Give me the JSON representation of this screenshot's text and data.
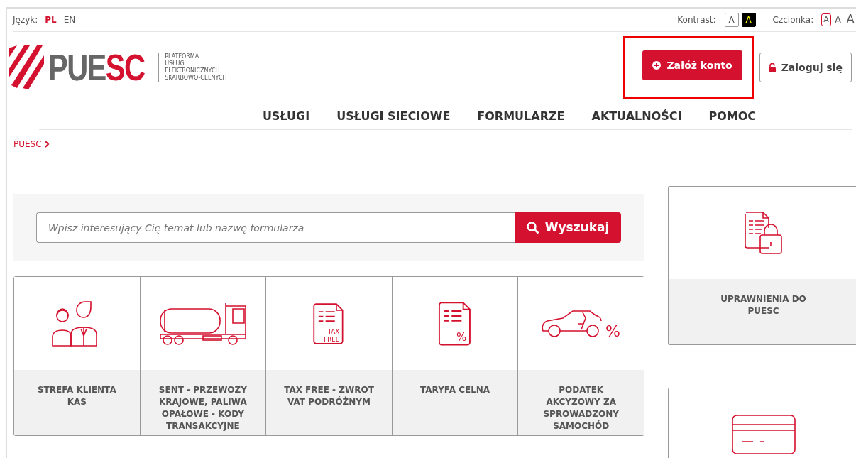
{
  "top_bar": {
    "language_label": "Język:",
    "languages": [
      {
        "label": "PL",
        "selected": true
      },
      {
        "label": "EN",
        "selected": false
      }
    ],
    "contrast_label": "Kontrast:",
    "contrast_options": [
      {
        "label": "A",
        "kind": "normal"
      },
      {
        "label": "A",
        "kind": "high"
      }
    ],
    "font_label": "Czcionka:",
    "font_sizes": [
      {
        "label": "A",
        "selected": true
      },
      {
        "label": "A",
        "selected": false
      },
      {
        "label": "A",
        "selected": false
      }
    ]
  },
  "logo": {
    "wordmark_grey": "PUE",
    "wordmark_red": "SC",
    "tagline": [
      "PLATFORMA",
      "USŁUG",
      "ELEKTRONICZNYCH",
      "SKARBOWO-CELNYCH"
    ]
  },
  "actions": [
    {
      "label": "Załóż konto",
      "kind": "primary",
      "highlighted": true
    },
    {
      "label": "Zaloguj się",
      "kind": "outline",
      "highlighted": false
    }
  ],
  "nav": [
    "USŁUGI",
    "USŁUGI SIECIOWE",
    "FORMULARZE",
    "AKTUALNOŚCI",
    "POMOC"
  ],
  "breadcrumb": [
    "PUESC"
  ],
  "search": {
    "placeholder": "Wpisz interesujący Cię temat lub nazwę formularza",
    "button": "Wyszukaj"
  },
  "tiles": [
    {
      "kind": "people",
      "label": "STREFA KLIENTA KAS"
    },
    {
      "kind": "truck",
      "label": "SENT - PRZEWOZY KRAJOWE, PALIWA OPAŁOWE - KODY TRANSAKCYJNE"
    },
    {
      "kind": "taxfree",
      "label": "TAX FREE - ZWROT VAT PODRÓŻNYM",
      "icon_text": [
        "TAX",
        "FREE"
      ]
    },
    {
      "kind": "tariff",
      "label": "TARYFA CELNA",
      "icon_text": [
        "%"
      ]
    },
    {
      "kind": "car",
      "label": "PODATEK AKCYZOWY ZA SPROWADZONY SAMOCHÓD",
      "icon_text": [
        "%"
      ]
    }
  ],
  "side_cards": [
    {
      "kind": "lockdoc",
      "label": "UPRAWNIENIA DO PUESC"
    },
    {
      "kind": "card"
    }
  ]
}
